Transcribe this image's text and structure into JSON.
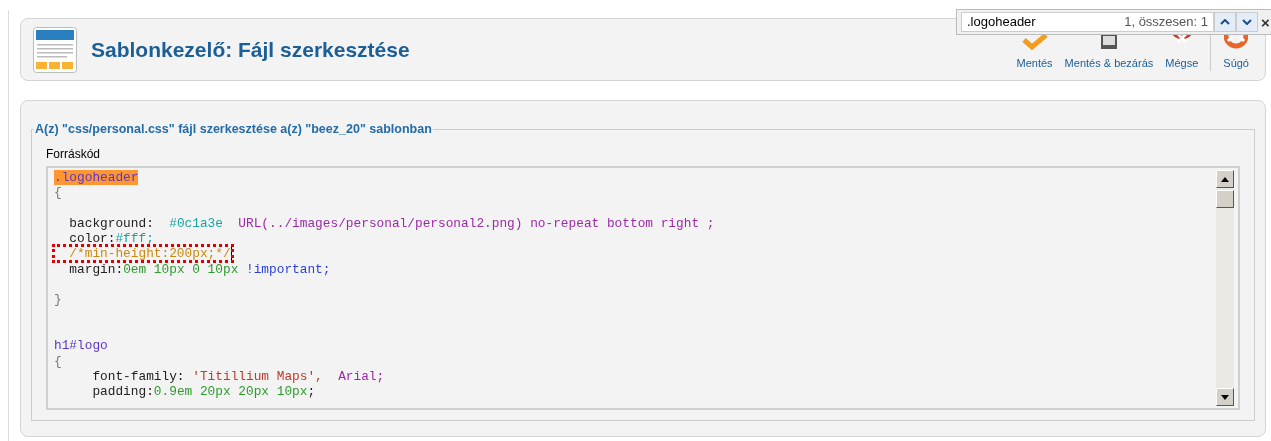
{
  "header": {
    "title": "Sablonkezelő: Fájl szerkesztése"
  },
  "toolbar": [
    {
      "kind": "save",
      "label": "Mentés"
    },
    {
      "kind": "save_close",
      "label": "Mentés & bezárás"
    },
    {
      "kind": "cancel",
      "label": "Mégse"
    },
    {
      "kind": "help",
      "label": "Súgó"
    }
  ],
  "find_bar": {
    "value": ".logoheader",
    "result": "1, összesen: 1",
    "close": "×"
  },
  "editor": {
    "legend": "A(z) \"css/personal.css\" fájl szerkesztése a(z) \"beez_20\" sablonban",
    "label": "Forráskód",
    "lines": [
      {
        "tokens": [
          {
            "text": ".logoheader",
            "kind": "selector",
            "highlighted": true
          }
        ]
      },
      {
        "tokens": [
          {
            "text": "{",
            "kind": "brace"
          }
        ]
      },
      {
        "kind": "blank"
      },
      {
        "tokens": [
          {
            "text": "  background:  ",
            "kind": "property"
          },
          {
            "text": "#0c1a3e",
            "kind": "hex"
          },
          {
            "text": "  URL(../images/personal/personal2.png) no-repeat bottom right ;",
            "kind": "url"
          }
        ]
      },
      {
        "tokens": [
          {
            "text": "  color:",
            "kind": "property"
          },
          {
            "text": "#fff;",
            "kind": "hex"
          }
        ]
      },
      {
        "tokens": [
          {
            "text": "  /*min-height:200px;*/",
            "kind": "comment",
            "boxed": true,
            "cursor": true
          }
        ]
      },
      {
        "tokens": [
          {
            "text": "  margin:",
            "kind": "property"
          },
          {
            "text": "0em 10px 0 10px ",
            "kind": "number"
          },
          {
            "text": "!important;",
            "kind": "keyword"
          }
        ]
      },
      {
        "kind": "blank"
      },
      {
        "tokens": [
          {
            "text": "}",
            "kind": "brace"
          }
        ]
      },
      {
        "kind": "blank"
      },
      {
        "kind": "blank"
      },
      {
        "tokens": [
          {
            "text": "h1#logo",
            "kind": "selector"
          }
        ]
      },
      {
        "tokens": [
          {
            "text": "{",
            "kind": "brace"
          }
        ]
      },
      {
        "tokens": [
          {
            "text": "     font-family: ",
            "kind": "property"
          },
          {
            "text": "'Titillium Maps',  ",
            "kind": "string"
          },
          {
            "text": "Arial;",
            "kind": "url"
          }
        ]
      },
      {
        "tokens": [
          {
            "text": "     padding:",
            "kind": "property"
          },
          {
            "text": "0.9em 20px 20px 10px",
            "kind": "number"
          },
          {
            "text": ";",
            "kind": "property"
          }
        ]
      }
    ]
  }
}
